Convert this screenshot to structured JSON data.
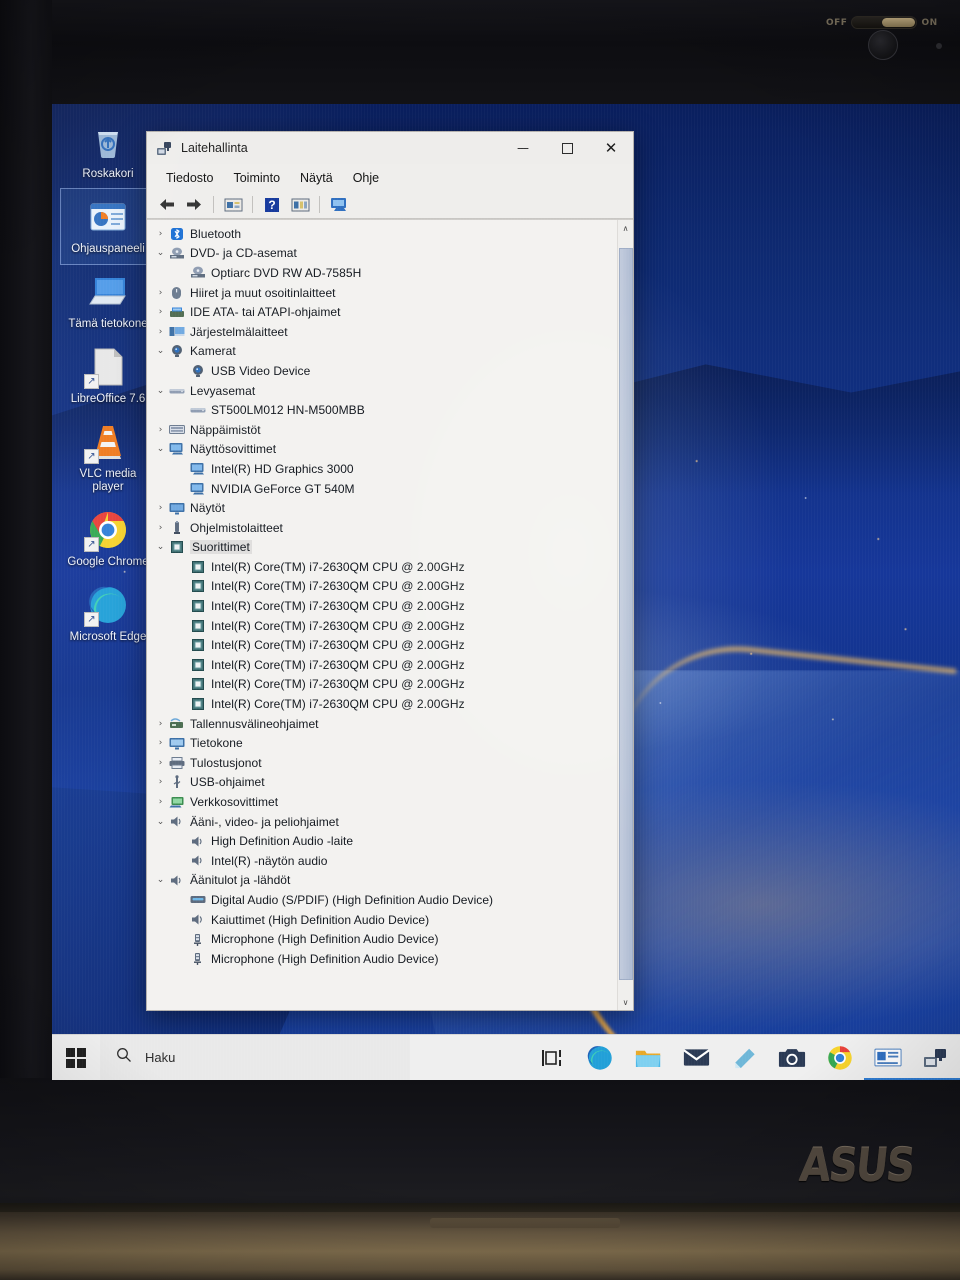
{
  "hardware": {
    "brand_logo": "ASUS",
    "power_switch": {
      "off_label": "OFF",
      "on_label": "ON",
      "state": "on"
    }
  },
  "desktop": {
    "icons": [
      {
        "label": "Roskakori",
        "icon": "recycle-bin-icon",
        "shortcut": false,
        "selected": false
      },
      {
        "label": "Ohjauspaneeli",
        "icon": "control-panel-icon",
        "shortcut": false,
        "selected": true
      },
      {
        "label": "Tämä tietokone",
        "icon": "this-pc-icon",
        "shortcut": false,
        "selected": false
      },
      {
        "label": "LibreOffice 7.6",
        "icon": "libreoffice-icon",
        "shortcut": true,
        "selected": false
      },
      {
        "label": "VLC media player",
        "icon": "vlc-icon",
        "shortcut": true,
        "selected": false
      },
      {
        "label": "Google Chrome",
        "icon": "chrome-icon",
        "shortcut": true,
        "selected": false
      },
      {
        "label": "Microsoft Edge",
        "icon": "edge-icon",
        "shortcut": true,
        "selected": false
      }
    ]
  },
  "window": {
    "title": "Laitehallinta",
    "icon": "device-manager-icon",
    "controls": {
      "minimize": "—",
      "maximize": "☐",
      "close": "✕"
    },
    "menu": [
      "Tiedosto",
      "Toiminto",
      "Näytä",
      "Ohje"
    ],
    "toolbar": [
      {
        "name": "back-button",
        "glyph": "←"
      },
      {
        "name": "forward-button",
        "glyph": "→"
      },
      {
        "name": "properties-button",
        "glyph": "▤"
      },
      {
        "name": "help-button",
        "glyph": "?"
      },
      {
        "name": "show-hidden-devices-button",
        "glyph": "▥"
      },
      {
        "name": "scan-for-hardware-changes-button",
        "glyph": "⌗"
      }
    ],
    "tree": [
      {
        "label": "Bluetooth",
        "indent": 1,
        "state": "collapsed",
        "icon": "bluetooth-icon"
      },
      {
        "label": "DVD- ja CD-asemat",
        "indent": 1,
        "state": "expanded",
        "icon": "optical-drive-icon"
      },
      {
        "label": "Optiarc DVD RW AD-7585H",
        "indent": 2,
        "state": "leaf",
        "icon": "optical-drive-icon"
      },
      {
        "label": "Hiiret ja muut osoitinlaitteet",
        "indent": 1,
        "state": "collapsed",
        "icon": "mouse-icon"
      },
      {
        "label": "IDE ATA- tai ATAPI-ohjaimet",
        "indent": 1,
        "state": "collapsed",
        "icon": "ide-controller-icon"
      },
      {
        "label": "Järjestelmälaitteet",
        "indent": 1,
        "state": "collapsed",
        "icon": "system-device-icon"
      },
      {
        "label": "Kamerat",
        "indent": 1,
        "state": "expanded",
        "icon": "camera-icon"
      },
      {
        "label": "USB Video Device",
        "indent": 2,
        "state": "leaf",
        "icon": "camera-icon"
      },
      {
        "label": "Levyasemat",
        "indent": 1,
        "state": "expanded",
        "icon": "disk-drive-icon"
      },
      {
        "label": "ST500LM012 HN-M500MBB",
        "indent": 2,
        "state": "leaf",
        "icon": "disk-drive-icon"
      },
      {
        "label": "Näppäimistöt",
        "indent": 1,
        "state": "collapsed",
        "icon": "keyboard-icon"
      },
      {
        "label": "Näyttösovittimet",
        "indent": 1,
        "state": "expanded",
        "icon": "display-adapter-icon"
      },
      {
        "label": "Intel(R) HD Graphics 3000",
        "indent": 2,
        "state": "leaf",
        "icon": "display-adapter-icon"
      },
      {
        "label": "NVIDIA GeForce GT 540M",
        "indent": 2,
        "state": "leaf",
        "icon": "display-adapter-icon"
      },
      {
        "label": "Näytöt",
        "indent": 1,
        "state": "collapsed",
        "icon": "monitor-icon"
      },
      {
        "label": "Ohjelmistolaitteet",
        "indent": 1,
        "state": "collapsed",
        "icon": "software-device-icon"
      },
      {
        "label": "Suorittimet",
        "indent": 1,
        "state": "expanded",
        "icon": "processor-icon",
        "selected": true
      },
      {
        "label": "Intel(R) Core(TM) i7-2630QM CPU @ 2.00GHz",
        "indent": 2,
        "state": "leaf",
        "icon": "processor-icon"
      },
      {
        "label": "Intel(R) Core(TM) i7-2630QM CPU @ 2.00GHz",
        "indent": 2,
        "state": "leaf",
        "icon": "processor-icon"
      },
      {
        "label": "Intel(R) Core(TM) i7-2630QM CPU @ 2.00GHz",
        "indent": 2,
        "state": "leaf",
        "icon": "processor-icon"
      },
      {
        "label": "Intel(R) Core(TM) i7-2630QM CPU @ 2.00GHz",
        "indent": 2,
        "state": "leaf",
        "icon": "processor-icon"
      },
      {
        "label": "Intel(R) Core(TM) i7-2630QM CPU @ 2.00GHz",
        "indent": 2,
        "state": "leaf",
        "icon": "processor-icon"
      },
      {
        "label": "Intel(R) Core(TM) i7-2630QM CPU @ 2.00GHz",
        "indent": 2,
        "state": "leaf",
        "icon": "processor-icon"
      },
      {
        "label": "Intel(R) Core(TM) i7-2630QM CPU @ 2.00GHz",
        "indent": 2,
        "state": "leaf",
        "icon": "processor-icon"
      },
      {
        "label": "Intel(R) Core(TM) i7-2630QM CPU @ 2.00GHz",
        "indent": 2,
        "state": "leaf",
        "icon": "processor-icon"
      },
      {
        "label": "Tallennusvälineohjaimet",
        "indent": 1,
        "state": "collapsed",
        "icon": "storage-controller-icon"
      },
      {
        "label": "Tietokone",
        "indent": 1,
        "state": "collapsed",
        "icon": "computer-icon"
      },
      {
        "label": "Tulostusjonot",
        "indent": 1,
        "state": "collapsed",
        "icon": "print-queue-icon"
      },
      {
        "label": "USB-ohjaimet",
        "indent": 1,
        "state": "collapsed",
        "icon": "usb-controller-icon"
      },
      {
        "label": "Verkkosovittimet",
        "indent": 1,
        "state": "collapsed",
        "icon": "network-adapter-icon"
      },
      {
        "label": "Ääni-, video- ja peliohjaimet",
        "indent": 1,
        "state": "expanded",
        "icon": "sound-icon"
      },
      {
        "label": "High Definition Audio -laite",
        "indent": 2,
        "state": "leaf",
        "icon": "sound-icon"
      },
      {
        "label": "Intel(R) -näytön audio",
        "indent": 2,
        "state": "leaf",
        "icon": "sound-icon"
      },
      {
        "label": "Äänitulot ja -lähdöt",
        "indent": 1,
        "state": "expanded",
        "icon": "sound-icon"
      },
      {
        "label": "Digital Audio (S/PDIF) (High Definition Audio Device)",
        "indent": 2,
        "state": "leaf",
        "icon": "spdif-icon"
      },
      {
        "label": "Kaiuttimet (High Definition Audio Device)",
        "indent": 2,
        "state": "leaf",
        "icon": "speaker-icon"
      },
      {
        "label": "Microphone (High Definition Audio Device)",
        "indent": 2,
        "state": "leaf",
        "icon": "microphone-icon"
      },
      {
        "label": "Microphone (High Definition Audio Device)",
        "indent": 2,
        "state": "leaf",
        "icon": "microphone-icon"
      }
    ],
    "scrollbar": {
      "up_arrow": "∧",
      "down_arrow": "∨"
    }
  },
  "taskbar": {
    "start": "start-button",
    "search_placeholder": "Haku",
    "search_icon": "search-icon",
    "icons": [
      {
        "name": "task-view-icon",
        "label": "Task View"
      },
      {
        "name": "edge-icon",
        "label": "Microsoft Edge"
      },
      {
        "name": "file-explorer-icon",
        "label": "File Explorer"
      },
      {
        "name": "mail-icon",
        "label": "Mail"
      },
      {
        "name": "sticky-notes-icon",
        "label": "Sticky Notes"
      },
      {
        "name": "camera-icon",
        "label": "Camera"
      },
      {
        "name": "chrome-icon",
        "label": "Google Chrome"
      },
      {
        "name": "news-icon",
        "label": "News"
      },
      {
        "name": "device-manager-icon",
        "label": "Laitehallinta"
      }
    ]
  },
  "colors": {
    "accent": "#2e7bd1",
    "window_bg": "#efeeec",
    "tree_bg": "#f3f2f0",
    "taskbar_bg": "#efefef",
    "desktop_blue": "#123a93"
  }
}
